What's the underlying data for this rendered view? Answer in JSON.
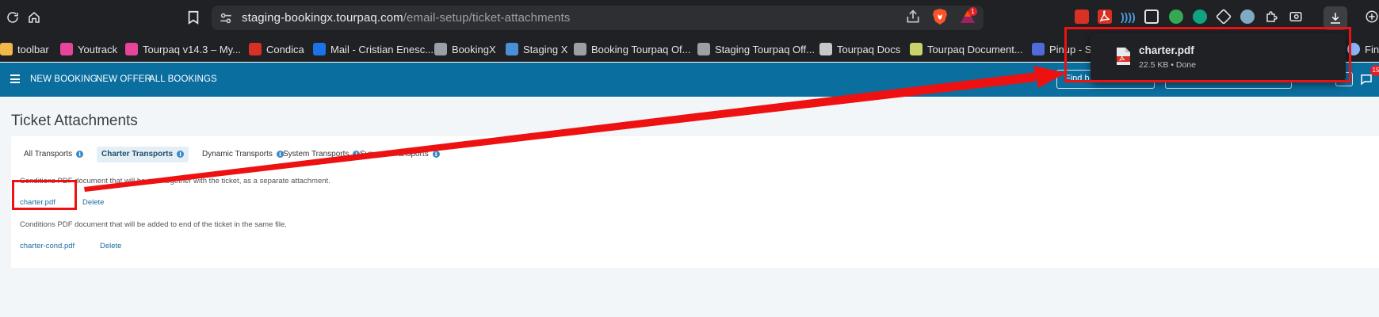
{
  "browser": {
    "url_host": "staging-bookingx.tourpaq.com",
    "url_path": "/email-setup/ticket-attachments",
    "bat_badge": "1",
    "bookmarks": [
      {
        "label": "toolbar",
        "color": "#f2b84b"
      },
      {
        "label": "Youtrack",
        "color": "#e8459a"
      },
      {
        "label": "Tourpaq v14.3 – My...",
        "color": "#e8459a"
      },
      {
        "label": "Condica",
        "color": "#d93025"
      },
      {
        "label": "Mail - Cristian Enesc...",
        "color": "#1a73e8"
      },
      {
        "label": "BookingX",
        "color": "#9aa0a6"
      },
      {
        "label": "Staging X",
        "color": "#4a90d9"
      },
      {
        "label": "Booking Tourpaq Of...",
        "color": "#9aa0a6"
      },
      {
        "label": "Staging Tourpaq Off...",
        "color": "#9aa0a6"
      },
      {
        "label": "Tourpaq Docs",
        "color": "#c8c8c8"
      },
      {
        "label": "Tourpaq Document...",
        "color": "#c9d26b"
      },
      {
        "label": "Pinup - Sti",
        "color": "#4f6bd9"
      }
    ],
    "find_label": "Find"
  },
  "app": {
    "nav": [
      "NEW BOOKING",
      "NEW OFFER",
      "ALL BOOKINGS"
    ],
    "header_field_1": "Find b",
    "chat_badge": "15"
  },
  "page": {
    "title": "Ticket Attachments",
    "tabs": [
      {
        "label": "All Transports",
        "active": false
      },
      {
        "label": "Charter Transports",
        "active": true
      },
      {
        "label": "Dynamic Transports",
        "active": false
      },
      {
        "label": "System Transports",
        "active": false
      },
      {
        "label": "Sys-real Transports",
        "active": false
      }
    ],
    "separate_desc": "Conditions PDF document that will be sent together with the ticket, as a separate attachment.",
    "separate_file": "charter.pdf",
    "separate_delete": "Delete",
    "same_desc": "Conditions PDF document that will be added to end of the ticket in the same file.",
    "same_file": "charter-cond.pdf",
    "same_delete": "Delete"
  },
  "download": {
    "file_name": "charter.pdf",
    "status": "22.5 KB • Done"
  },
  "colors": {
    "browser_bg": "#202124",
    "app_header": "#0a6e9f",
    "link": "#1a6ea0",
    "annotation": "#ee1111"
  }
}
